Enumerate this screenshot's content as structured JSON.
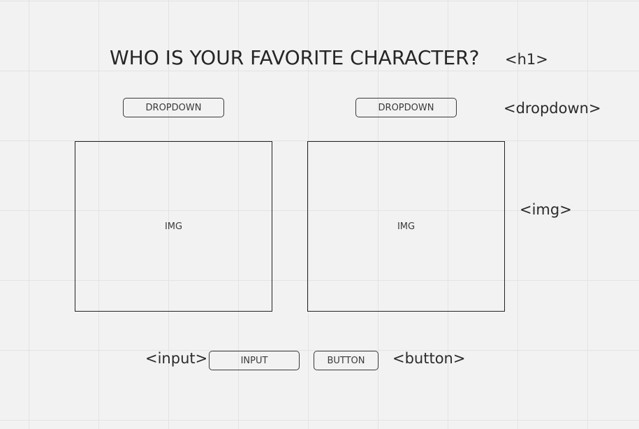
{
  "heading": "WHO IS YOUR FAVORITE CHARACTER?",
  "tags": {
    "h1": "<h1>",
    "dropdown": "<dropdown>",
    "img": "<img>",
    "input": "<input>",
    "button": "<button>"
  },
  "dropdowns": [
    {
      "label": "DROPDOWN"
    },
    {
      "label": "DROPDOWN"
    }
  ],
  "images": [
    {
      "label": "IMG"
    },
    {
      "label": "IMG"
    }
  ],
  "input": {
    "label": "INPUT"
  },
  "button": {
    "label": "BUTTON"
  }
}
